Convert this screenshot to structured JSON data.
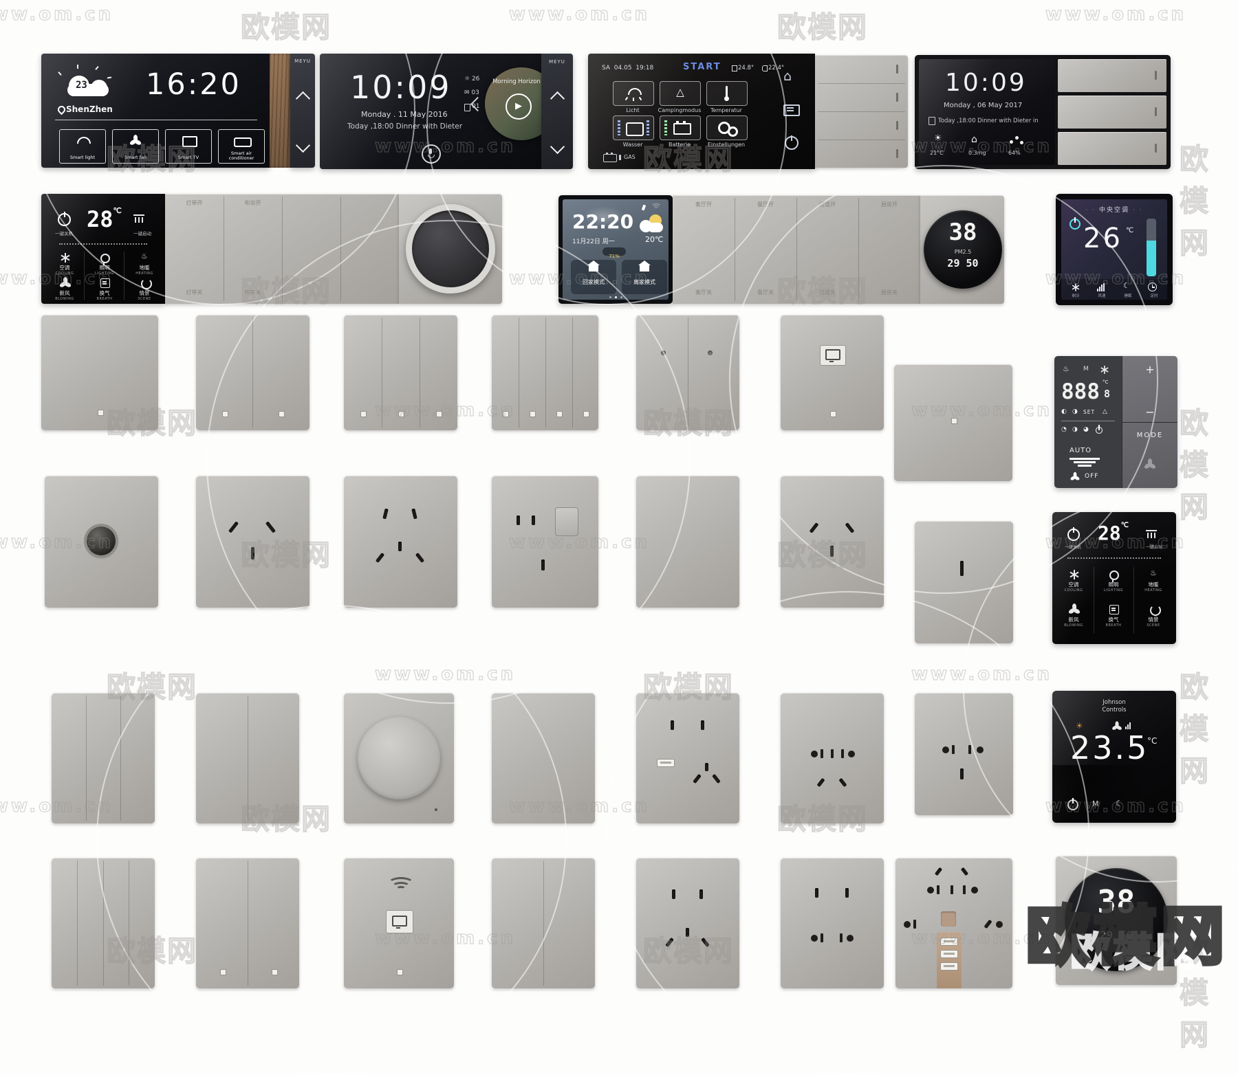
{
  "watermark": {
    "brand": "欧模网",
    "url": "www.om.cn",
    "stamp": "欧模网"
  },
  "icons": {
    "sun": "☀",
    "sun_outline": "☼",
    "moon": "☾",
    "home": "⌂",
    "mail": "✉",
    "play": "▶",
    "tent": "△",
    "warning": "△",
    "heat": "♨",
    "half_left": "◐",
    "half_right": "◑",
    "quarter": "◔",
    "three_quarter": "◕"
  },
  "weather_panel": {
    "brand": "MEYU",
    "temp": "23°",
    "city": "ShenZhen",
    "time": "16:20",
    "b1": "Smart light",
    "b2": "Smart fan",
    "b3": "Smart TV",
    "b4": "Smart air conditioner"
  },
  "media_panel": {
    "brand": "MEYU",
    "time": "10:09",
    "date": "Monday . 11 May 2016",
    "event": "Today ,18:00  Dinner with Dieter",
    "weather_temp": "26",
    "mail_count": "03",
    "note_count": "01",
    "album": "Morning Horizon"
  },
  "camper_panel": {
    "day": "SA",
    "date": "04.05",
    "clock": "19:18",
    "start": "START",
    "temp_inside": "24.8°",
    "temp_outside": "22.4°",
    "licht": "Licht",
    "camping": "Campingmodus",
    "temperatur": "Temperatur",
    "wasser": "Wasser",
    "batterie": "Batterie",
    "einstellungen": "Einstellungen",
    "gas": "GAS"
  },
  "schedule_panel": {
    "time": "10:09",
    "date": "Monday , 06 May 2017",
    "event": "Today ,18:00  Dinner with Dieter in",
    "stat_temp": "21°C",
    "stat_pm": "0.3mg",
    "stat_hum": "64%"
  },
  "scene_panel": {
    "temp": "28",
    "unit": "℃",
    "off_label": "一键关机",
    "on_label": "一键启动",
    "g1": "空调",
    "g1s": "COOLING",
    "g2": "照明",
    "g2s": "LIGHTING",
    "g3": "地暖",
    "g3s": "HEATING",
    "g4": "新风",
    "g4s": "BLOWING",
    "g5": "换气",
    "g5s": "BREATH",
    "g6": "情景",
    "g6s": "SCENE",
    "m_top1": "灯带开",
    "m_top2": "布帘开",
    "m_bot1": "灯带关",
    "m_bot2": "布帘关"
  },
  "home_panel": {
    "time": "22:20",
    "date": "11月22日 周一",
    "temp": "20℃",
    "battery": "71%",
    "mode_home": "回家模式",
    "mode_away": "离家模式",
    "m_top1": "客厅开",
    "m_top2": "餐厅开",
    "m_top3": "过道开",
    "m_top4": "厨房开",
    "m_bot1": "客厅关",
    "m_bot2": "餐厅关",
    "m_bot3": "过道关",
    "m_bot4": "厨房关"
  },
  "pm_dial": {
    "value": "38",
    "label": "PM2.5",
    "sub": "29 50"
  },
  "ac_panel": {
    "title": "中央空调",
    "temp": "26",
    "unit": "℃",
    "i1": "制冷",
    "i2": "风速",
    "i3": "睡眠",
    "i4": "定时"
  },
  "thermostat_panel": {
    "m": "M",
    "display": "888",
    "display_dec": "8",
    "unit": "°C",
    "set": "SET",
    "auto": "AUTO",
    "off": "OFF",
    "plus": "+",
    "minus": "−",
    "mode": "MODE"
  },
  "johnson_panel": {
    "brand1": "Johnson",
    "brand2": "Controls",
    "temp": "23.5",
    "unit": "°C",
    "m": "M"
  },
  "pm_dial_big": {
    "value": "38",
    "sub": "29 50"
  }
}
